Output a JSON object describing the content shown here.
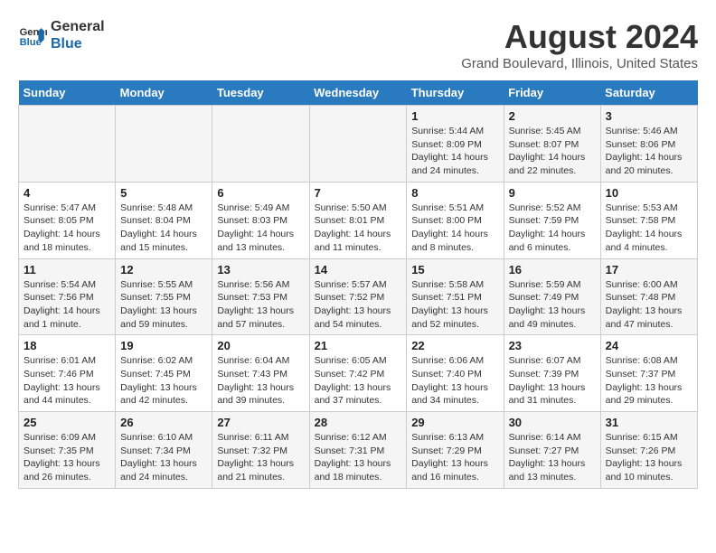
{
  "header": {
    "logo_line1": "General",
    "logo_line2": "Blue",
    "title": "August 2024",
    "subtitle": "Grand Boulevard, Illinois, United States"
  },
  "days_of_week": [
    "Sunday",
    "Monday",
    "Tuesday",
    "Wednesday",
    "Thursday",
    "Friday",
    "Saturday"
  ],
  "weeks": [
    [
      {
        "day": "",
        "info": ""
      },
      {
        "day": "",
        "info": ""
      },
      {
        "day": "",
        "info": ""
      },
      {
        "day": "",
        "info": ""
      },
      {
        "day": "1",
        "info": "Sunrise: 5:44 AM\nSunset: 8:09 PM\nDaylight: 14 hours\nand 24 minutes."
      },
      {
        "day": "2",
        "info": "Sunrise: 5:45 AM\nSunset: 8:07 PM\nDaylight: 14 hours\nand 22 minutes."
      },
      {
        "day": "3",
        "info": "Sunrise: 5:46 AM\nSunset: 8:06 PM\nDaylight: 14 hours\nand 20 minutes."
      }
    ],
    [
      {
        "day": "4",
        "info": "Sunrise: 5:47 AM\nSunset: 8:05 PM\nDaylight: 14 hours\nand 18 minutes."
      },
      {
        "day": "5",
        "info": "Sunrise: 5:48 AM\nSunset: 8:04 PM\nDaylight: 14 hours\nand 15 minutes."
      },
      {
        "day": "6",
        "info": "Sunrise: 5:49 AM\nSunset: 8:03 PM\nDaylight: 14 hours\nand 13 minutes."
      },
      {
        "day": "7",
        "info": "Sunrise: 5:50 AM\nSunset: 8:01 PM\nDaylight: 14 hours\nand 11 minutes."
      },
      {
        "day": "8",
        "info": "Sunrise: 5:51 AM\nSunset: 8:00 PM\nDaylight: 14 hours\nand 8 minutes."
      },
      {
        "day": "9",
        "info": "Sunrise: 5:52 AM\nSunset: 7:59 PM\nDaylight: 14 hours\nand 6 minutes."
      },
      {
        "day": "10",
        "info": "Sunrise: 5:53 AM\nSunset: 7:58 PM\nDaylight: 14 hours\nand 4 minutes."
      }
    ],
    [
      {
        "day": "11",
        "info": "Sunrise: 5:54 AM\nSunset: 7:56 PM\nDaylight: 14 hours\nand 1 minute."
      },
      {
        "day": "12",
        "info": "Sunrise: 5:55 AM\nSunset: 7:55 PM\nDaylight: 13 hours\nand 59 minutes."
      },
      {
        "day": "13",
        "info": "Sunrise: 5:56 AM\nSunset: 7:53 PM\nDaylight: 13 hours\nand 57 minutes."
      },
      {
        "day": "14",
        "info": "Sunrise: 5:57 AM\nSunset: 7:52 PM\nDaylight: 13 hours\nand 54 minutes."
      },
      {
        "day": "15",
        "info": "Sunrise: 5:58 AM\nSunset: 7:51 PM\nDaylight: 13 hours\nand 52 minutes."
      },
      {
        "day": "16",
        "info": "Sunrise: 5:59 AM\nSunset: 7:49 PM\nDaylight: 13 hours\nand 49 minutes."
      },
      {
        "day": "17",
        "info": "Sunrise: 6:00 AM\nSunset: 7:48 PM\nDaylight: 13 hours\nand 47 minutes."
      }
    ],
    [
      {
        "day": "18",
        "info": "Sunrise: 6:01 AM\nSunset: 7:46 PM\nDaylight: 13 hours\nand 44 minutes."
      },
      {
        "day": "19",
        "info": "Sunrise: 6:02 AM\nSunset: 7:45 PM\nDaylight: 13 hours\nand 42 minutes."
      },
      {
        "day": "20",
        "info": "Sunrise: 6:04 AM\nSunset: 7:43 PM\nDaylight: 13 hours\nand 39 minutes."
      },
      {
        "day": "21",
        "info": "Sunrise: 6:05 AM\nSunset: 7:42 PM\nDaylight: 13 hours\nand 37 minutes."
      },
      {
        "day": "22",
        "info": "Sunrise: 6:06 AM\nSunset: 7:40 PM\nDaylight: 13 hours\nand 34 minutes."
      },
      {
        "day": "23",
        "info": "Sunrise: 6:07 AM\nSunset: 7:39 PM\nDaylight: 13 hours\nand 31 minutes."
      },
      {
        "day": "24",
        "info": "Sunrise: 6:08 AM\nSunset: 7:37 PM\nDaylight: 13 hours\nand 29 minutes."
      }
    ],
    [
      {
        "day": "25",
        "info": "Sunrise: 6:09 AM\nSunset: 7:35 PM\nDaylight: 13 hours\nand 26 minutes."
      },
      {
        "day": "26",
        "info": "Sunrise: 6:10 AM\nSunset: 7:34 PM\nDaylight: 13 hours\nand 24 minutes."
      },
      {
        "day": "27",
        "info": "Sunrise: 6:11 AM\nSunset: 7:32 PM\nDaylight: 13 hours\nand 21 minutes."
      },
      {
        "day": "28",
        "info": "Sunrise: 6:12 AM\nSunset: 7:31 PM\nDaylight: 13 hours\nand 18 minutes."
      },
      {
        "day": "29",
        "info": "Sunrise: 6:13 AM\nSunset: 7:29 PM\nDaylight: 13 hours\nand 16 minutes."
      },
      {
        "day": "30",
        "info": "Sunrise: 6:14 AM\nSunset: 7:27 PM\nDaylight: 13 hours\nand 13 minutes."
      },
      {
        "day": "31",
        "info": "Sunrise: 6:15 AM\nSunset: 7:26 PM\nDaylight: 13 hours\nand 10 minutes."
      }
    ]
  ]
}
